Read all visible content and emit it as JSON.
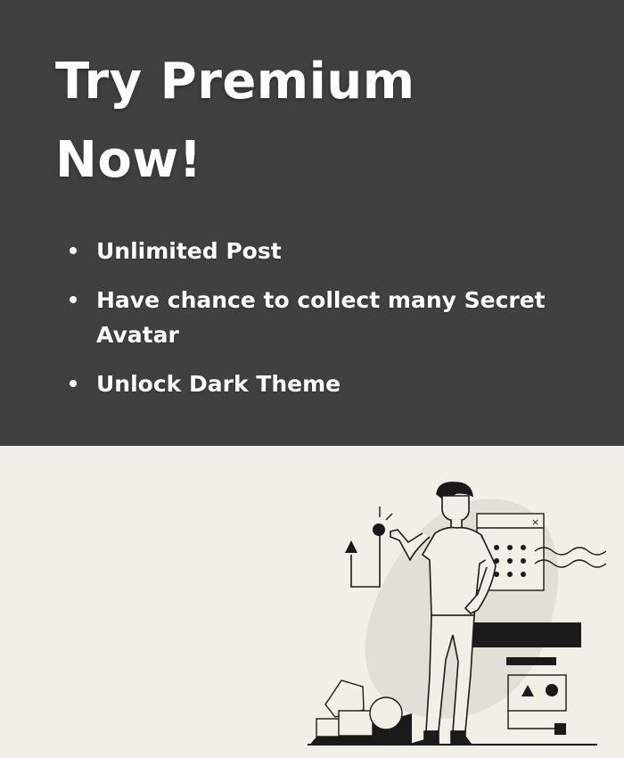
{
  "hero": {
    "title_line1": "Try Premium",
    "title_line2": "Now!",
    "benefits": [
      "Unlimited Post",
      "Have chance to collect many Secret Avatar",
      "Unlock Dark Theme"
    ]
  },
  "illustration": {
    "icon": "man-presenting-illustration"
  },
  "colors": {
    "hero_background": "#404040",
    "page_background": "#f1efe6",
    "text": "#ffffff"
  }
}
